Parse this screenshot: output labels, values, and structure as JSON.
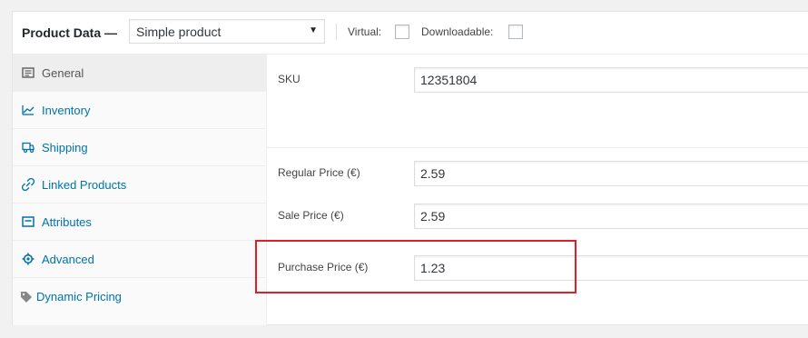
{
  "header": {
    "title": "Product Data —",
    "product_type": "Simple product",
    "virtual_label": "Virtual:",
    "downloadable_label": "Downloadable:"
  },
  "sidebar": {
    "items": [
      {
        "label": "General",
        "icon": "general-icon"
      },
      {
        "label": "Inventory",
        "icon": "inventory-icon"
      },
      {
        "label": "Shipping",
        "icon": "shipping-icon"
      },
      {
        "label": "Linked Products",
        "icon": "link-icon"
      },
      {
        "label": "Attributes",
        "icon": "attributes-icon"
      },
      {
        "label": "Advanced",
        "icon": "gear-icon"
      },
      {
        "label": "Dynamic Pricing",
        "icon": "tag-icon"
      }
    ]
  },
  "fields": {
    "sku": {
      "label": "SKU",
      "value": "12351804"
    },
    "regular_price": {
      "label": "Regular Price (€)",
      "value": "2.59"
    },
    "sale_price": {
      "label": "Sale Price (€)",
      "value": "2.59"
    },
    "purchase_price": {
      "label": "Purchase Price (€)",
      "value": "1.23"
    }
  },
  "colors": {
    "link": "#0073aa",
    "highlight": "#dd1f26"
  }
}
